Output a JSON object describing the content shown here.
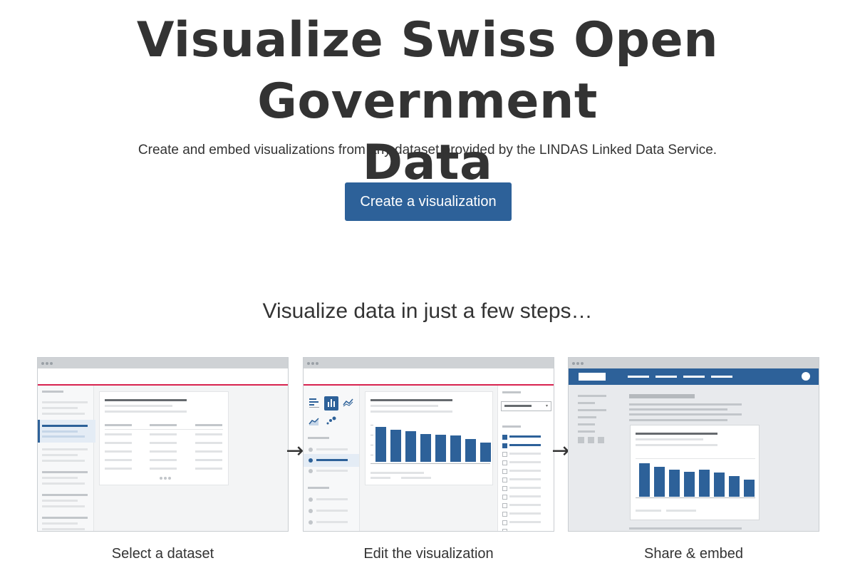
{
  "hero": {
    "title_line1": "Visualize Swiss Open Government",
    "title_line2": "Data",
    "subtitle": "Create and embed visualizations from any dataset provided by the LINDAS Linked Data Service.",
    "cta_label": "Create a visualization"
  },
  "steps": {
    "heading": "Visualize data in just a few steps…",
    "items": [
      {
        "label": "Select a dataset"
      },
      {
        "label": "Edit the visualization"
      },
      {
        "label": "Share & embed"
      }
    ]
  },
  "illustration": {
    "edit_chart_levels": [
      0.95,
      0.87,
      0.82,
      0.75,
      0.74,
      0.71,
      0.62,
      0.52
    ],
    "share_chart_levels": [
      0.93,
      0.83,
      0.76,
      0.69,
      0.75,
      0.67,
      0.58,
      0.48
    ]
  },
  "colors": {
    "brand_blue": "#2d6199",
    "accent_red": "#d8234f",
    "text": "#333333"
  },
  "icons": [
    "arrow-right-icon",
    "bar-chart-icon",
    "column-chart-icon",
    "line-chart-icon",
    "area-chart-icon",
    "scatter-chart-icon",
    "window-dots-icon"
  ]
}
